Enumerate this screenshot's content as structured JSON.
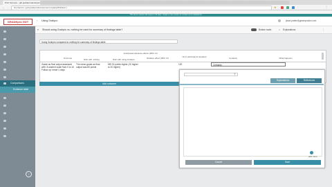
{
  "browser": {
    "tabs": [
      "Print Sensore - gdt.gradeprodevelopment.org/pre…",
      "",
      "",
      "",
      "",
      "",
      "",
      "",
      "",
      "",
      "",
      "",
      ""
    ],
    "url": "Not Secure | gdt.gradeprodevelopment.org/app/#/tickets/ | …",
    "bookmarks": [
      "",
      "",
      "",
      "",
      "",
      "",
      "",
      "",
      ""
    ],
    "banner": "This demo version will expire in 29 days. Create a new version or contact us for assistance."
  },
  "header": {
    "logo": "GRADEpro GDT",
    "title": "Using Grabpro",
    "user": "jesse.patter@gradeprodev.com"
  },
  "sidebar": {
    "items": [
      "",
      "",
      "",
      "",
      "",
      "",
      "",
      "Comparisons",
      "Evidence table",
      "",
      "",
      "",
      "",
      "",
      ""
    ]
  },
  "question": {
    "text": "Should using Grabpro vs. nothing be used for summary of findings table?",
    "toggle_label": "Bottom swint",
    "explanations_label": "Explanations"
  },
  "summary": {
    "text": "Using Grabpro compared to nothing for summary of findings table"
  },
  "table": {
    "headers": {
      "outcome": "Outcome",
      "anticipated": "Anticipated absolute effects (95% CI)",
      "risk_without": "Risk with nothing",
      "risk_with": "Risk with using Grabpro",
      "relative": "Relative effect (95% CI)",
      "participants": "№ of participants (studies)",
      "certainty": "Certainty",
      "what_happens": "What happens"
    },
    "row": {
      "outcome": "Grade as final output assessed with: 5-student scale from 0 to 10 Follow up: mean 1 days",
      "risk_without": "The mean grade as final output was 80 points",
      "risk_with": "MD 15 points higher (10 higher to 20 higher)",
      "participants": "120",
      "certainty_value": "Certainty"
    }
  },
  "add_outcome_label": "Add outcome",
  "popup": {
    "search_placeholder": "",
    "tab_explanations": "Explanations",
    "tab_references": "References",
    "add_more": "add more",
    "cancel_label": "Cancel",
    "save_label": "Save"
  },
  "colors": {
    "sidebar": "#7e8b95",
    "accent": "#2a6f80",
    "banner": "#2f8c8c",
    "button": "#3a8fa8"
  }
}
